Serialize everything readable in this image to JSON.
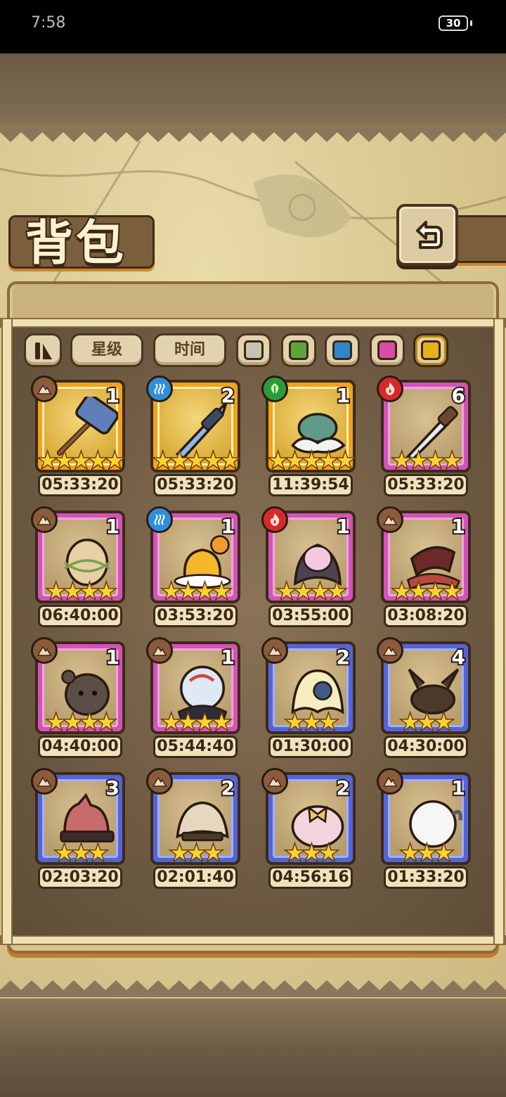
{
  "status_bar": {
    "time": "7:58",
    "battery": "30"
  },
  "header": {
    "title": "背包"
  },
  "filters": {
    "sort_buttons": [
      {
        "label": "星级"
      },
      {
        "label": "时间"
      }
    ],
    "color_filters": [
      {
        "name": "gray",
        "color": "#c9c2b0",
        "selected": false
      },
      {
        "name": "green",
        "color": "#5aa63a",
        "selected": false
      },
      {
        "name": "blue",
        "color": "#2f86c9",
        "selected": false
      },
      {
        "name": "pink",
        "color": "#d94aa6",
        "selected": false
      },
      {
        "name": "gold",
        "color": "#e6b21c",
        "selected": true
      }
    ]
  },
  "items": [
    {
      "art": "hammer-icon",
      "element": "earth",
      "rarity": "gold",
      "count": "1",
      "stars": "★★★★★",
      "timer": "05:33:20"
    },
    {
      "art": "sword-icon",
      "element": "water",
      "rarity": "gold",
      "count": "2",
      "stars": "★★★★★",
      "timer": "05:33:20"
    },
    {
      "art": "flower-helm-icon",
      "element": "nature",
      "rarity": "gold",
      "count": "1",
      "stars": "★★★★★",
      "timer": "11:39:54"
    },
    {
      "art": "dagger-icon",
      "element": "fire",
      "rarity": "pink",
      "count": "6",
      "stars": "★★★★",
      "timer": "05:33:20"
    },
    {
      "art": "egg-nest-icon",
      "element": "earth",
      "rarity": "pink",
      "count": "1",
      "stars": "★★★★",
      "timer": "06:40:00"
    },
    {
      "art": "pudding-icon",
      "element": "water",
      "rarity": "pink",
      "count": "1",
      "stars": "★★★★",
      "timer": "03:53:20"
    },
    {
      "art": "demon-mask-icon",
      "element": "fire",
      "rarity": "pink",
      "count": "1",
      "stars": "★★★★",
      "timer": "03:55:00"
    },
    {
      "art": "horn-bag-icon",
      "element": "earth",
      "rarity": "pink",
      "count": "1",
      "stars": "★★★★",
      "timer": "03:08:20"
    },
    {
      "art": "bear-plush-icon",
      "element": "earth",
      "rarity": "pink",
      "count": "1",
      "stars": "★★★★",
      "timer": "04:40:00"
    },
    {
      "art": "crystal-orb-icon",
      "element": "earth",
      "rarity": "pink",
      "count": "1",
      "stars": "★★★★",
      "timer": "05:44:40"
    },
    {
      "art": "jellyfish-hat-icon",
      "element": "earth",
      "rarity": "blue",
      "count": "2",
      "stars": "★★★",
      "timer": "01:30:00"
    },
    {
      "art": "leaf-pouch-icon",
      "element": "earth",
      "rarity": "blue",
      "count": "4",
      "stars": "★★★",
      "timer": "04:30:00"
    },
    {
      "art": "cat-hat-icon",
      "element": "earth",
      "rarity": "blue",
      "count": "3",
      "stars": "★★★",
      "timer": "02:03:20"
    },
    {
      "art": "fur-cap-icon",
      "element": "earth",
      "rarity": "blue",
      "count": "2",
      "stars": "★★★",
      "timer": "02:01:40"
    },
    {
      "art": "bow-bonnet-icon",
      "element": "earth",
      "rarity": "blue",
      "count": "2",
      "stars": "★★★",
      "timer": "04:56:16"
    },
    {
      "art": "ram-wool-icon",
      "element": "earth",
      "rarity": "blue",
      "count": "1",
      "stars": "★★★",
      "timer": "01:33:20"
    }
  ]
}
